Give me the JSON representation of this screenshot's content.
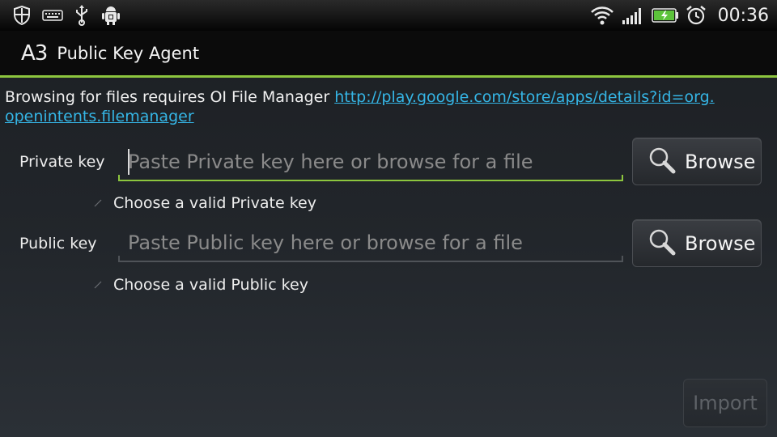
{
  "status_bar": {
    "time": "00:36",
    "left_icons": [
      "shield-icon",
      "keyboard-icon",
      "usb-icon",
      "android-debug-icon"
    ],
    "right_icons": [
      "wifi-icon",
      "signal-icon",
      "battery-charging-icon",
      "alarm-clock-icon"
    ]
  },
  "titlebar": {
    "logo": "A3",
    "title": "Public Key Agent"
  },
  "info": {
    "text": "Browsing for files requires OI File Manager ",
    "link": "http://play.google.com/store/apps/details?id=org.openintents.filemanager",
    "link_line1": "http://play.google.com/store/apps/details?id=org.",
    "link_line2": "openintents.filemanager"
  },
  "private_key": {
    "label": "Private key",
    "placeholder": "Paste Private key here or browse for a file",
    "browse_label": "Browse",
    "hint": "Choose a valid Private key"
  },
  "public_key": {
    "label": "Public key",
    "placeholder": "Paste Public key here or browse for a file",
    "browse_label": "Browse",
    "hint": "Choose a valid Public key"
  },
  "import_label": "Import",
  "colors": {
    "accent": "#8dc53e",
    "link": "#35b5e5",
    "disabled_text": "#5e6267"
  }
}
